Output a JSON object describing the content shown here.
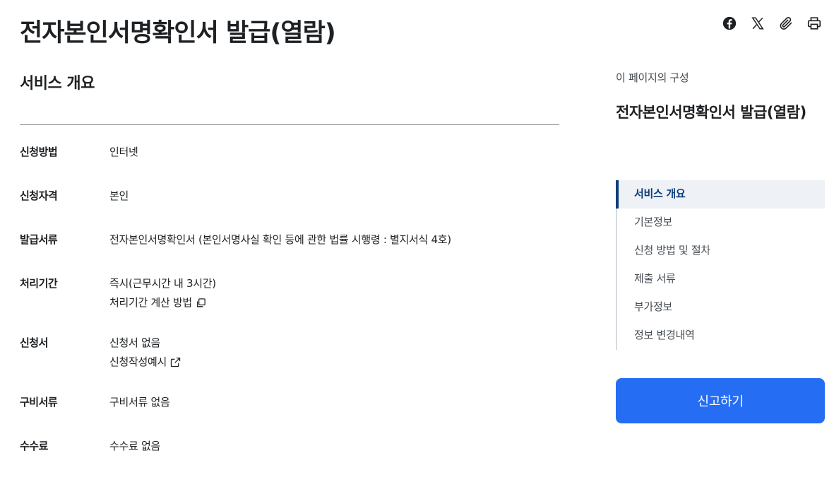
{
  "page": {
    "title": "전자본인서명확인서 발급(열람)"
  },
  "share": {
    "icons": [
      "facebook-icon",
      "x-icon",
      "paperclip-icon",
      "print-icon"
    ]
  },
  "overview": {
    "title": "서비스 개요",
    "rows": [
      {
        "label": "신청방법",
        "values": [
          {
            "text": "인터넷"
          }
        ]
      },
      {
        "label": "신청자격",
        "values": [
          {
            "text": "본인"
          }
        ]
      },
      {
        "label": "발급서류",
        "values": [
          {
            "text": "전자본인서명확인서 (본인서명사실 확인 등에 관한 법률 시행령 : 별지서식 4호)"
          }
        ]
      },
      {
        "label": "처리기간",
        "values": [
          {
            "text": "즉시(근무시간 내 3시간)"
          },
          {
            "text": "처리기간 계산 방법",
            "icon": "copy-icon"
          }
        ]
      },
      {
        "label": "신청서",
        "values": [
          {
            "text": "신청서 없음"
          },
          {
            "text": "신청작성예시",
            "icon": "external-link-icon"
          }
        ]
      },
      {
        "label": "구비서류",
        "values": [
          {
            "text": "구비서류 없음"
          }
        ]
      },
      {
        "label": "수수료",
        "values": [
          {
            "text": "수수료 없음"
          }
        ]
      }
    ]
  },
  "toc": {
    "caption": "이 페이지의 구성",
    "title": "전자본인서명확인서 발급(열람)",
    "items": [
      {
        "label": "서비스 개요",
        "active": true
      },
      {
        "label": "기본정보",
        "active": false
      },
      {
        "label": "신청 방법 및 절차",
        "active": false
      },
      {
        "label": "제출 서류",
        "active": false
      },
      {
        "label": "부가정보",
        "active": false
      },
      {
        "label": "정보 변경내역",
        "active": false
      }
    ]
  },
  "actions": {
    "report_label": "신고하기"
  },
  "colors": {
    "accent": "#256ef4",
    "toc_active": "#0b3c7a",
    "toc_active_bg": "#eef1f5"
  }
}
